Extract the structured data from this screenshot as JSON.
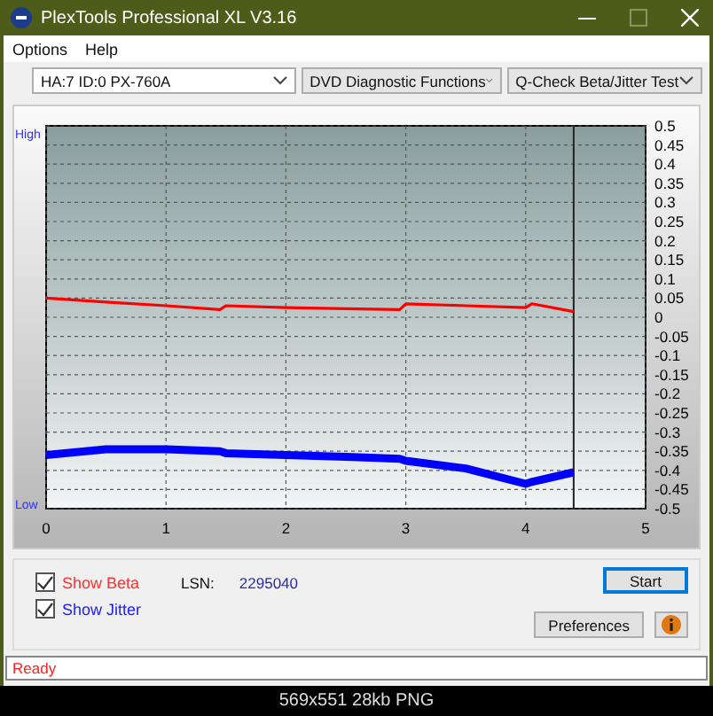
{
  "window": {
    "title": "PlexTools Professional XL V3.16"
  },
  "menu": [
    {
      "label": "Options"
    },
    {
      "label": "Help"
    }
  ],
  "toolbar": {
    "drive": "HA:7 ID:0  PX-760A",
    "function": "DVD Diagnostic Functions",
    "test": "Q-Check Beta/Jitter Test"
  },
  "chart": {
    "high_label": "High",
    "low_label": "Low",
    "chart_data": {
      "type": "line",
      "x": [
        0,
        0.5,
        1,
        1.45,
        1.5,
        2,
        2.5,
        2.95,
        3,
        3.5,
        4,
        4.05,
        4.4
      ],
      "series": [
        {
          "color": "#ff0000",
          "values": [
            0.05,
            0.04,
            0.03,
            0.02,
            0.03,
            0.025,
            0.022,
            0.02,
            0.035,
            0.03,
            0.025,
            0.035,
            0.015
          ]
        },
        {
          "color": "#0000ff",
          "values": [
            -0.36,
            -0.345,
            -0.345,
            -0.35,
            -0.355,
            -0.36,
            -0.365,
            -0.37,
            -0.375,
            -0.395,
            -0.435,
            -0.43,
            -0.405
          ]
        }
      ],
      "xlim": [
        0,
        5
      ],
      "ylim": [
        -0.5,
        0.5
      ],
      "grid": true,
      "xticks": [
        0,
        1,
        2,
        3,
        4,
        5
      ],
      "yticks": [
        {
          "value": 0.5,
          "label": "0.5"
        },
        {
          "value": 0.45,
          "label": "0.45"
        },
        {
          "value": 0.4,
          "label": "0.4"
        },
        {
          "value": 0.35,
          "label": "0.35"
        },
        {
          "value": 0.3,
          "label": "0.3"
        },
        {
          "value": 0.25,
          "label": "0.25"
        },
        {
          "value": 0.2,
          "label": "0.2"
        },
        {
          "value": 0.15,
          "label": "0.15"
        },
        {
          "value": 0.1,
          "label": "0.1"
        },
        {
          "value": 0.05,
          "label": "0.05"
        },
        {
          "value": 0,
          "label": "0"
        },
        {
          "value": -0.05,
          "label": "-0.05"
        },
        {
          "value": -0.1,
          "label": "-0.1"
        },
        {
          "value": -0.15,
          "label": "-0.15"
        },
        {
          "value": -0.2,
          "label": "-0.2"
        },
        {
          "value": -0.25,
          "label": "-0.25"
        },
        {
          "value": -0.3,
          "label": "-0.3"
        },
        {
          "value": -0.35,
          "label": "-0.35"
        },
        {
          "value": -0.4,
          "label": "-0.4"
        },
        {
          "value": -0.45,
          "label": "-0.45"
        },
        {
          "value": -0.5,
          "label": "-0.5"
        }
      ],
      "ref_lines": [
        {
          "axis": "x",
          "value": 4.4,
          "color": "#222222"
        }
      ]
    }
  },
  "options": [
    {
      "label": "Show Beta",
      "checked": true,
      "color": "#ff3030"
    },
    {
      "label": "Show Jitter",
      "checked": true,
      "color": "#2020ff"
    }
  ],
  "lsn": {
    "label": "LSN:",
    "value": "2295040"
  },
  "buttons": {
    "start": {
      "label": "Start"
    },
    "preferences": {
      "label": "Preferences"
    }
  },
  "status_bar": {
    "text": "Ready"
  },
  "caption": "569x551 28kb PNG"
}
